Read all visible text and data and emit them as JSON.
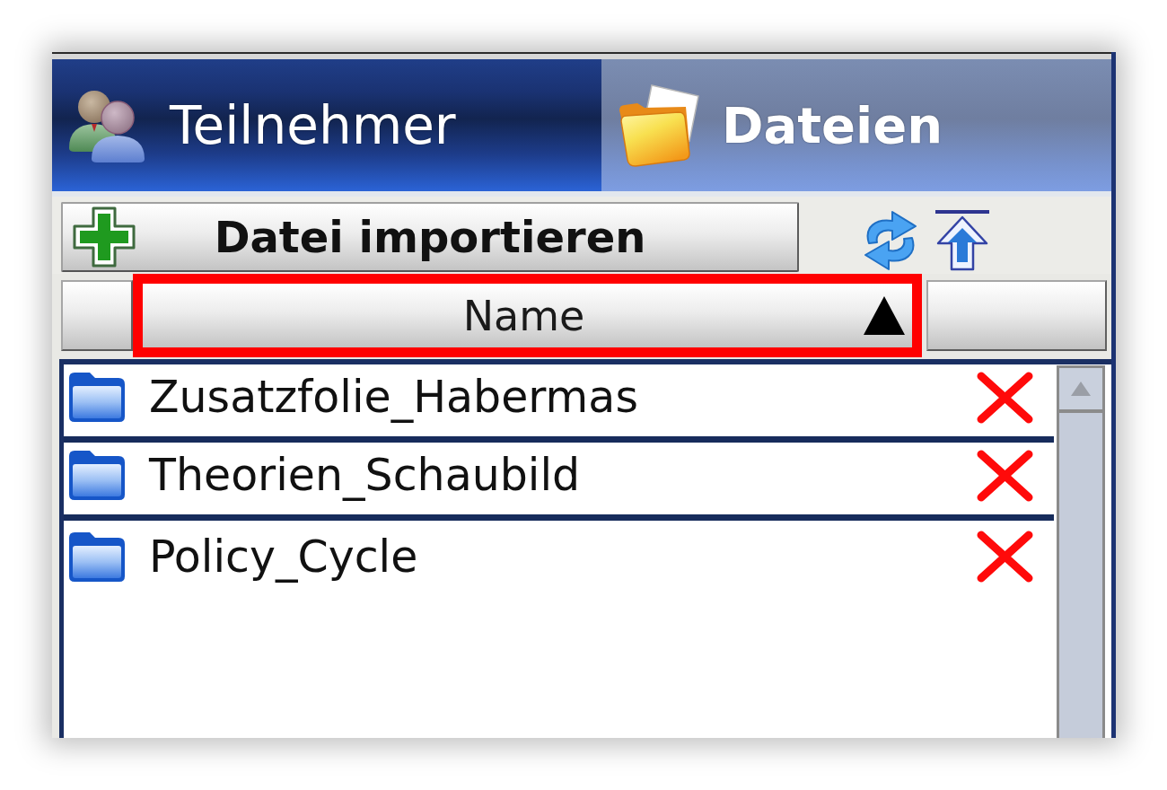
{
  "tabs": [
    {
      "kind": "participants",
      "label": "Teilnehmer",
      "selected": false
    },
    {
      "kind": "files",
      "label": "Dateien",
      "selected": true
    }
  ],
  "toolbar": {
    "import_button": {
      "label": "Datei importieren"
    }
  },
  "file_list": {
    "name_column": {
      "label": "Name",
      "sort_ascending": true,
      "highlighted": true
    },
    "rows": [
      {
        "label": "Zusatzfolie_Habermas"
      },
      {
        "label": "Theorien_Schaubild"
      },
      {
        "label": "Policy_Cycle"
      }
    ]
  }
}
